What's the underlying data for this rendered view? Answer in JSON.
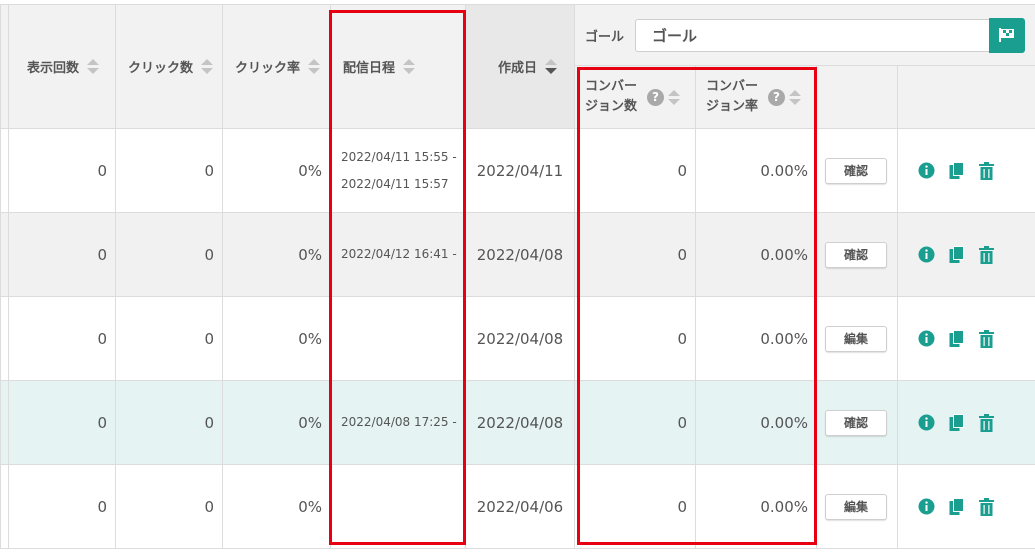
{
  "columns": {
    "impressions": "表示回数",
    "clicks": "クリック数",
    "ctr": "クリック率",
    "schedule": "配信日程",
    "created": "作成日",
    "conversions": [
      "コンバー",
      "ジョン数"
    ],
    "cvr": [
      "コンバー",
      "ジョン率"
    ]
  },
  "goal": {
    "label": "ゴール",
    "value": "ゴール"
  },
  "colors": {
    "accent": "#1a9e8f",
    "highlight_border": "#e60012",
    "row_highlight": "#e5f3f3"
  },
  "rows": [
    {
      "impressions": "0",
      "clicks": "0",
      "ctr": "0%",
      "schedule_start": "2022/04/11 15:55 -",
      "schedule_end": "2022/04/11 15:57",
      "created": "2022/04/11",
      "conversions": "0",
      "cvr": "0.00%",
      "action": "確認"
    },
    {
      "impressions": "0",
      "clicks": "0",
      "ctr": "0%",
      "schedule_start": "2022/04/12 16:41 -",
      "schedule_end": "",
      "created": "2022/04/08",
      "conversions": "0",
      "cvr": "0.00%",
      "action": "確認"
    },
    {
      "impressions": "0",
      "clicks": "0",
      "ctr": "0%",
      "schedule_start": "",
      "schedule_end": "",
      "created": "2022/04/08",
      "conversions": "0",
      "cvr": "0.00%",
      "action": "編集"
    },
    {
      "impressions": "0",
      "clicks": "0",
      "ctr": "0%",
      "schedule_start": "2022/04/08 17:25 -",
      "schedule_end": "",
      "created": "2022/04/08",
      "conversions": "0",
      "cvr": "0.00%",
      "action": "確認"
    },
    {
      "impressions": "0",
      "clicks": "0",
      "ctr": "0%",
      "schedule_start": "",
      "schedule_end": "",
      "created": "2022/04/06",
      "conversions": "0",
      "cvr": "0.00%",
      "action": "編集"
    }
  ],
  "icons": [
    "info-icon",
    "copy-icon",
    "trash-icon"
  ]
}
